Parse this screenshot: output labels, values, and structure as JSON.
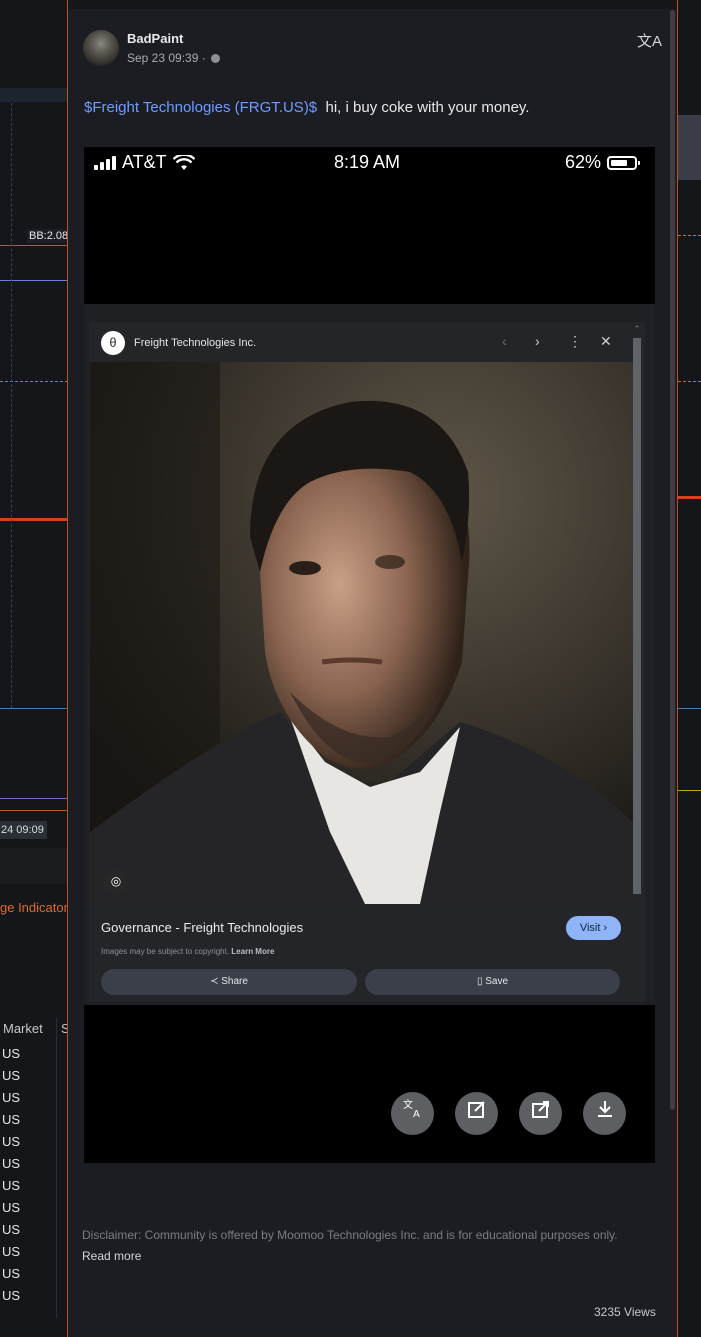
{
  "background": {
    "bb_label": "BB:2.08",
    "time_tag": "24 09:09",
    "indicator_label": "ge Indicator",
    "table_headers": [
      "Market",
      "S"
    ],
    "market_rows": [
      "US",
      "US",
      "US",
      "US",
      "US",
      "US",
      "US",
      "US",
      "US",
      "US",
      "US",
      "US"
    ]
  },
  "post": {
    "author": "BadPaint",
    "time": "Sep 23 09:39 ·",
    "ticker": "$Freight Technologies (FRGT.US)$",
    "body": "hi, i buy coke with your money.",
    "translate_icon": "文A"
  },
  "screenshot": {
    "carrier": "AT&T",
    "time": "8:19 AM",
    "battery": "62%",
    "site_name": "Freight Technologies Inc.",
    "result_title": "Governance - Freight Technologies",
    "visit_label": "Visit ›",
    "copyright_text": "Images may be subject to copyright.",
    "learn_more": "Learn More",
    "share_label": "Share",
    "save_label": "Save",
    "site_icon_glyph": "θ",
    "lens_icon_glyph": "◎",
    "nav_back": "‹",
    "nav_forward": "›",
    "nav_menu": "⋮",
    "nav_close": "✕",
    "share_glyph": "≺",
    "save_glyph": "▯",
    "action_icons": [
      "translate-icon",
      "edit-icon",
      "share-icon",
      "download-icon"
    ]
  },
  "footer": {
    "disclaimer": "Disclaimer: Community is offered by Moomoo Technologies Inc. and is for educational purposes only.",
    "read_more": "Read more",
    "views": "3235 Views"
  }
}
